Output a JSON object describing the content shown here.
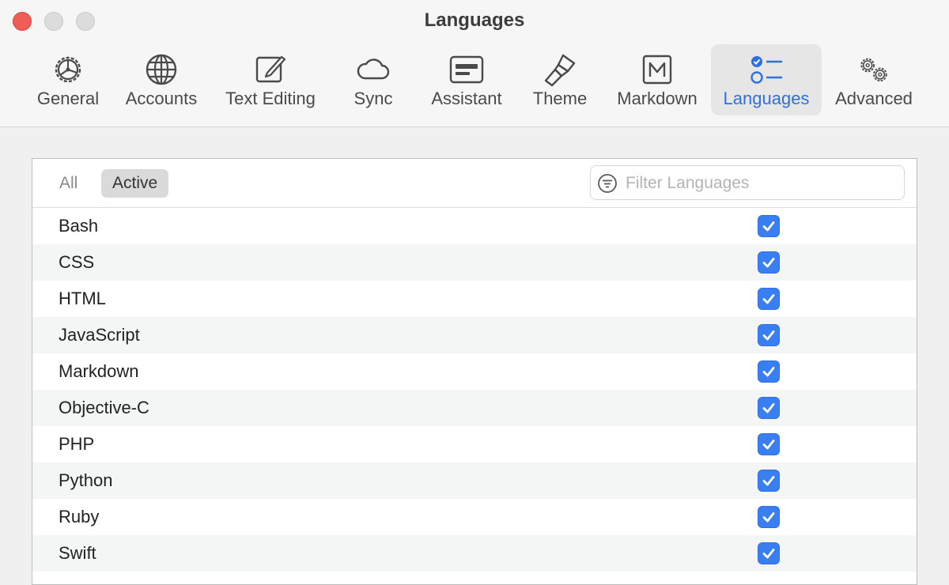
{
  "window": {
    "title": "Languages"
  },
  "toolbar": {
    "items": [
      {
        "label": "General",
        "icon": "general-gear-icon"
      },
      {
        "label": "Accounts",
        "icon": "globe-icon"
      },
      {
        "label": "Text Editing",
        "icon": "edit-pencil-icon"
      },
      {
        "label": "Sync",
        "icon": "cloud-icon"
      },
      {
        "label": "Assistant",
        "icon": "assistant-panel-icon"
      },
      {
        "label": "Theme",
        "icon": "paintbrush-icon"
      },
      {
        "label": "Markdown",
        "icon": "markdown-m-icon"
      },
      {
        "label": "Languages",
        "icon": "list-checklist-icon"
      },
      {
        "label": "Advanced",
        "icon": "gears-icon"
      }
    ],
    "selected": "Languages",
    "accent_color": "#2f6fe0"
  },
  "filter": {
    "segments": [
      "All",
      "Active"
    ],
    "selected_segment": "Active",
    "search_placeholder": "Filter Languages",
    "search_value": ""
  },
  "languages": [
    {
      "name": "Bash",
      "checked": true
    },
    {
      "name": "CSS",
      "checked": true
    },
    {
      "name": "HTML",
      "checked": true
    },
    {
      "name": "JavaScript",
      "checked": true
    },
    {
      "name": "Markdown",
      "checked": true
    },
    {
      "name": "Objective-C",
      "checked": true
    },
    {
      "name": "PHP",
      "checked": true
    },
    {
      "name": "Python",
      "checked": true
    },
    {
      "name": "Ruby",
      "checked": true
    },
    {
      "name": "Swift",
      "checked": true
    }
  ],
  "checkbox_color": "#3a7ff2"
}
